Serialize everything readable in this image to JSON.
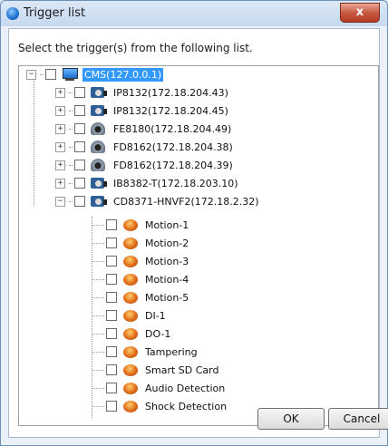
{
  "window": {
    "title": "Trigger list",
    "close_label": "x"
  },
  "prompt": "Select the trigger(s) from the following list.",
  "tree": {
    "root": {
      "label": "CMS(127.0.0.1)",
      "icon": "computer-icon",
      "expanded": true,
      "selected": true
    },
    "devices": [
      {
        "label": "IP8132(172.18.204.43)",
        "icon": "box-camera-icon",
        "expanded": false
      },
      {
        "label": "IP8132(172.18.204.45)",
        "icon": "box-camera-icon",
        "expanded": false
      },
      {
        "label": "FE8180(172.18.204.49)",
        "icon": "fisheye-camera-icon",
        "expanded": false
      },
      {
        "label": "FD8162(172.18.204.38)",
        "icon": "dome-camera-icon",
        "expanded": false
      },
      {
        "label": "FD8162(172.18.204.39)",
        "icon": "dome-camera-icon",
        "expanded": false
      },
      {
        "label": "IB8382-T(172.18.203.10)",
        "icon": "box-camera-icon",
        "expanded": false
      },
      {
        "label": "CD8371-HNVF2(172.18.2.32)",
        "icon": "box-camera-icon",
        "expanded": true
      }
    ],
    "events": [
      "Motion-1",
      "Motion-2",
      "Motion-3",
      "Motion-4",
      "Motion-5",
      "DI-1",
      "DO-1",
      "Tampering",
      "Smart SD Card",
      "Audio Detection",
      "Shock Detection"
    ]
  },
  "buttons": {
    "ok": "OK",
    "cancel": "Cancel"
  }
}
